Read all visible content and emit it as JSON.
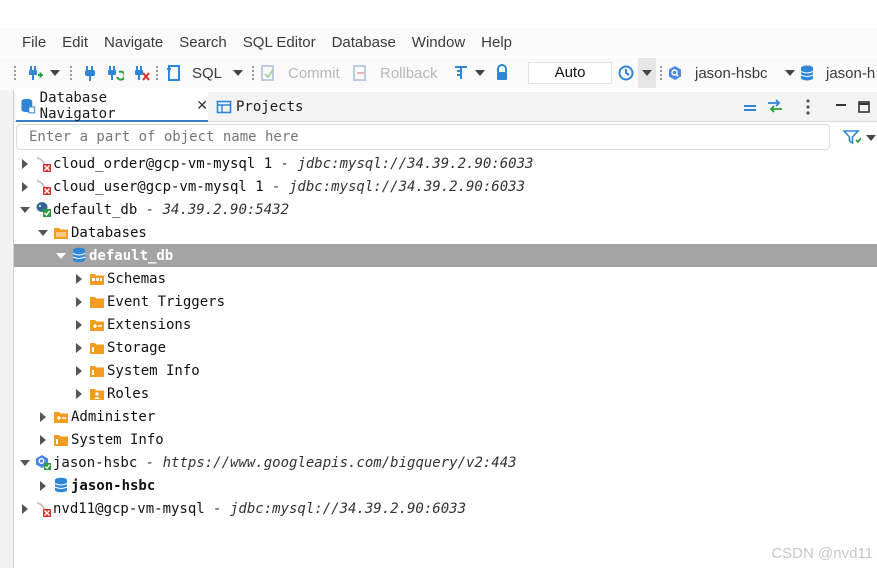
{
  "menu": [
    "File",
    "Edit",
    "Navigate",
    "Search",
    "SQL Editor",
    "Database",
    "Window",
    "Help"
  ],
  "toolbar": {
    "sql_label": "SQL",
    "commit_label": "Commit",
    "rollback_label": "Rollback",
    "transaction_mode": "Auto",
    "active_datasource": "jason-hsbc",
    "active_schema": "jason-h"
  },
  "tabs": {
    "navigator": "Database Navigator",
    "projects": "Projects"
  },
  "search": {
    "placeholder": "Enter a part of object name here"
  },
  "tree": {
    "cloud_order": {
      "name": "cloud_order@gcp-vm-mysql 1",
      "url": " - jdbc:mysql://34.39.2.90:6033"
    },
    "cloud_user": {
      "name": "cloud_user@gcp-vm-mysql 1",
      "url": " - jdbc:mysql://34.39.2.90:6033"
    },
    "default_db": {
      "name": "default_db",
      "url": " - 34.39.2.90:5432"
    },
    "databases": "Databases",
    "default_db_child": "default_db",
    "schemas": "Schemas",
    "event_triggers": "Event Triggers",
    "extensions": "Extensions",
    "storage": "Storage",
    "system_info_db": "System Info",
    "roles": "Roles",
    "administer": "Administer",
    "system_info": "System Info",
    "jason_hsbc": {
      "name": "jason-hsbc",
      "url": " - https://www.googleapis.com/bigquery/v2:443"
    },
    "jason_hsbc_child": "jason-hsbc",
    "nvd11": {
      "name": "nvd11@gcp-vm-mysql",
      "url": " - jdbc:mysql://34.39.2.90:6033"
    }
  },
  "watermark": "CSDN @nvd11",
  "colors": {
    "accent": "#3d7ec7",
    "folder": "#f39c1f",
    "selection": "#a4a4a4",
    "db_blue": "#2f86d6"
  }
}
